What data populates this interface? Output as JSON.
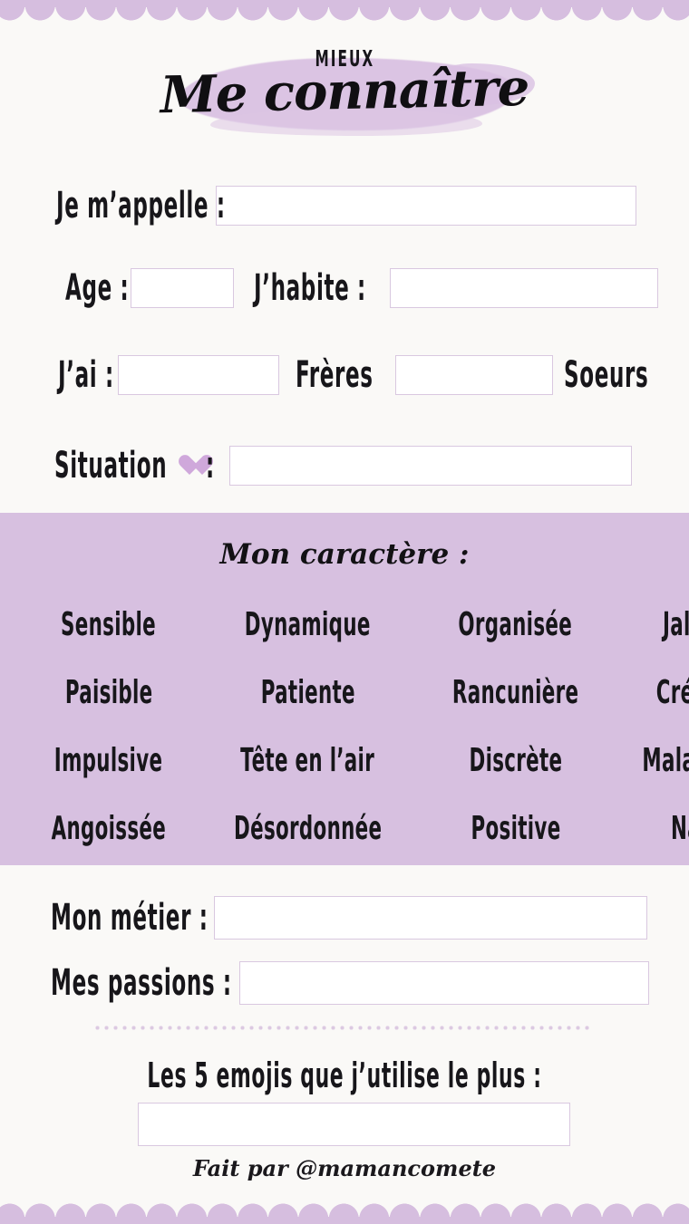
{
  "page": {
    "background_color": "#faf9f7",
    "accent_color": "#d7c0e0",
    "border_color": "#d9c8e0",
    "text_color": "#17161a"
  },
  "header": {
    "eyebrow": "MIEUX",
    "title": "Me connaître"
  },
  "identity_fields": [
    {
      "label": "Je m’appelle :",
      "value": "",
      "placeholder": ""
    },
    {
      "label": "Age :",
      "value": "",
      "placeholder": ""
    },
    {
      "label": "J’habite :",
      "value": "",
      "placeholder": ""
    },
    {
      "label": "J’ai :",
      "value": "",
      "placeholder": ""
    },
    {
      "label": "Frères",
      "value": "",
      "placeholder": ""
    },
    {
      "label": "Soeurs",
      "value": "",
      "placeholder": ""
    },
    {
      "label": "Situation",
      "suffix": ":",
      "icon": "heart-icon",
      "value": "",
      "placeholder": ""
    }
  ],
  "character": {
    "title": "Mon caractère :",
    "traits": [
      "Sensible",
      "Dynamique",
      "Organisée",
      "Jalouse",
      "Paisible",
      "Patiente",
      "Rancunière",
      "Créative",
      "Impulsive",
      "Tête en l’air",
      "Discrète",
      "Maladroite",
      "Angoissée",
      "Désordonnée",
      "Positive",
      "Naïve"
    ]
  },
  "life_fields": [
    {
      "label": "Mon métier :",
      "value": "",
      "placeholder": ""
    },
    {
      "label": "Mes passions :",
      "value": "",
      "placeholder": ""
    }
  ],
  "emoji_section": {
    "question": "Les 5 emojis que j’utilise le plus :",
    "value": "",
    "placeholder": ""
  },
  "footer": {
    "credit": "Fait par @mamancomete"
  }
}
